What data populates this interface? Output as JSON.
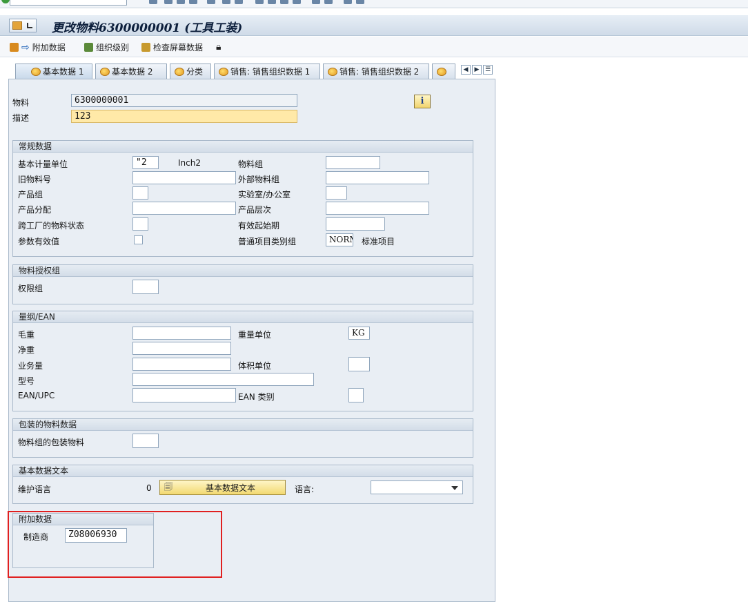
{
  "title": "更改物料6300000001 (工具工装)",
  "toolbar": {
    "additional_data": "附加数据",
    "org_levels": "组织级别",
    "check_screen_data": "检查屏幕数据"
  },
  "tabs": [
    {
      "label": "基本数据 1",
      "active": true
    },
    {
      "label": "基本数据 2",
      "active": false
    },
    {
      "label": "分类",
      "active": false
    },
    {
      "label": "销售: 销售组织数据 1",
      "active": false
    },
    {
      "label": "销售: 销售组织数据 2",
      "active": false
    },
    {
      "label": " ",
      "active": false
    }
  ],
  "header": {
    "material_label": "物料",
    "material_value": "6300000001",
    "description_label": "描述",
    "description_value": "123"
  },
  "general": {
    "title": "常规数据",
    "base_uom_label": "基本计量单位",
    "base_uom_value": "\"2",
    "base_uom_text": "Inch2",
    "material_group_label": "物料组",
    "material_group_value": "",
    "old_material_label": "旧物料号",
    "old_material_value": "",
    "ext_material_group_label": "外部物料组",
    "ext_material_group_value": "",
    "division_label": "产品组",
    "division_value": "",
    "lab_office_label": "实验室/办公室",
    "lab_office_value": "",
    "product_alloc_label": "产品分配",
    "product_alloc_value": "",
    "product_hierarchy_label": "产品层次",
    "product_hierarchy_value": "",
    "x_plant_status_label": "跨工厂的物料状态",
    "x_plant_status_value": "",
    "valid_from_label": "有效起始期",
    "valid_from_value": "",
    "param_eff_label": "参数有效值",
    "item_cat_group_label": "普通项目类别组",
    "item_cat_group_value": "NORM",
    "item_cat_group_text": "标准项目"
  },
  "auth": {
    "title": "物料授权组",
    "auth_group_label": "权限组",
    "auth_group_value": ""
  },
  "dimensions": {
    "title": "量纲/EAN",
    "gross_weight_label": "毛重",
    "gross_weight_value": "",
    "weight_unit_label": "重量单位",
    "weight_unit_value": "KG",
    "net_weight_label": "净重",
    "net_weight_value": "",
    "volume_label": "业务量",
    "volume_value": "",
    "volume_unit_label": "体积单位",
    "volume_unit_value": "",
    "size_label": "型号",
    "size_value": "",
    "ean_label": "EAN/UPC",
    "ean_value": "",
    "ean_category_label": "EAN 类别",
    "ean_category_value": ""
  },
  "packaging": {
    "title": "包装的物料数据",
    "pack_group_label": "物料组的包装物料",
    "pack_group_value": ""
  },
  "basic_text": {
    "title": "基本数据文本",
    "maintain_lang_label": "维护语言",
    "maintain_lang_count": "0",
    "button_label": "基本数据文本",
    "language_label": "语言:",
    "language_value": ""
  },
  "additional": {
    "title": "附加数据",
    "manufacturer_label": "制造商",
    "manufacturer_value": "Z08006930"
  }
}
